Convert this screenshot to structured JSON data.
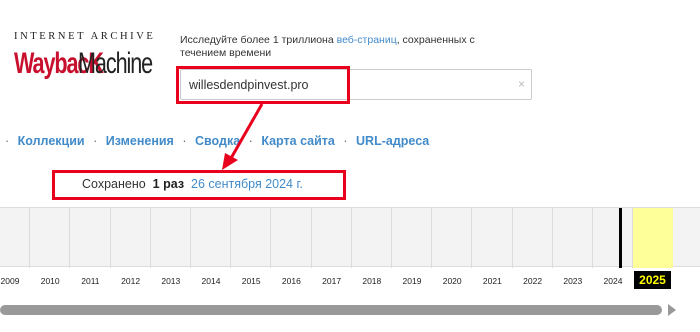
{
  "logo": {
    "top_text": "INTERNET ARCHIVE",
    "wordmark_left": "WaybacK",
    "wordmark_right": "Machine"
  },
  "description": {
    "before_link": "Исследуйте более 1 триллиона ",
    "link": "веб-страниц",
    "after_link": ", сохраненных с течением времени"
  },
  "search": {
    "value": "willesdendpinvest.pro",
    "clear_glyph": "×"
  },
  "nav": {
    "items": [
      {
        "label": "Коллекции"
      },
      {
        "label": "Изменения"
      },
      {
        "label": "Сводка"
      },
      {
        "label": "Карта сайта"
      },
      {
        "label": "URL-адреса"
      }
    ],
    "separator": "·"
  },
  "saved": {
    "prefix": "Сохранено",
    "count": "1 раз",
    "date_link": "26 сентября 2024 г."
  },
  "timeline": {
    "years": [
      "2009",
      "2010",
      "2011",
      "2012",
      "2013",
      "2014",
      "2015",
      "2016",
      "2017",
      "2018",
      "2019",
      "2020",
      "2021",
      "2022",
      "2023",
      "2024"
    ],
    "current_year": "2025"
  },
  "colors": {
    "highlight": "#e8001c",
    "link": "#428bca",
    "logo_red": "#c8102e",
    "current_year_bg": "#ffff99"
  }
}
